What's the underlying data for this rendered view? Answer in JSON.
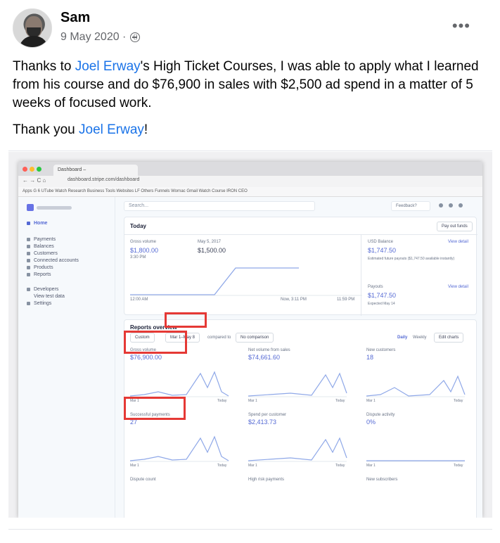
{
  "post": {
    "author": "Sam",
    "date": "9 May 2020 ·",
    "more": "•••",
    "paragraph1_pre": "Thanks to ",
    "paragraph1_link": "Joel Erway",
    "paragraph1_post": "'s High Ticket Courses, I was able to apply what I learned from his course and do $76,900 in sales with $2,500 ad spend in a matter of 5 weeks of focused work.",
    "paragraph2_pre": "Thank you ",
    "paragraph2_link": "Joel Erway",
    "paragraph2_post": "!"
  },
  "browser": {
    "tab_label": "Dashboard –",
    "url": "dashboard.stripe.com/dashboard",
    "bookmarks": "Apps  G  6  UTube  Watch  Research  Business  Tools  Websites  LF  Others  Funnels  Wornac  Gmail  Watch  Course  IRON CEO"
  },
  "dashboard": {
    "search_placeholder": "Search...",
    "feedback": "Feedback?",
    "sidebar": [
      "Home",
      "Payments",
      "Balances",
      "Customers",
      "Connected accounts",
      "Products",
      "Reports",
      "Developers",
      "View test data",
      "Settings"
    ],
    "today": {
      "title": "Today",
      "payout_button": "Pay out funds",
      "gross_label": "Gross volume",
      "gross_value": "$1,800.00",
      "gross_time": "3:30 PM",
      "compare_label": "May 5, 2017",
      "compare_value": "$1,500.00",
      "axis_start": "12:00 AM",
      "axis_mid": "Now, 3:11 PM",
      "axis_end": "11:59 PM",
      "usd_label": "USD Balance",
      "usd_value": "$1,747.50",
      "usd_note": "Estimated future payouts ($1,747.50 available instantly)",
      "view_details": "View detail",
      "payouts_label": "Payouts",
      "payouts_value": "$1,747.50",
      "payouts_note": "Expected May 14"
    },
    "reports": {
      "title": "Reports overview",
      "range_type": "Custom",
      "range": "Mar 1–May 8",
      "compared_to": "compared to",
      "comparison": "No comparison",
      "daily": "Daily",
      "weekly": "Weekly",
      "edit_charts": "Edit charts",
      "axis_start": "Mar 1",
      "axis_end": "Today",
      "metrics": [
        {
          "label": "Gross volume",
          "value": "$76,900.00"
        },
        {
          "label": "Net volume from sales",
          "value": "$74,661.60"
        },
        {
          "label": "New customers",
          "value": "18"
        },
        {
          "label": "Successful payments",
          "value": "27"
        },
        {
          "label": "Spend per customer",
          "value": "$2,413.73"
        },
        {
          "label": "Dispute activity",
          "value": "0%"
        },
        {
          "label": "Dispute count",
          "value": ""
        },
        {
          "label": "High risk payments",
          "value": ""
        },
        {
          "label": "New subscribers",
          "value": ""
        }
      ]
    }
  },
  "colors": {
    "link": "#1a73e8",
    "highlight": "#e53935",
    "stripe_blue": "#5469d4"
  }
}
